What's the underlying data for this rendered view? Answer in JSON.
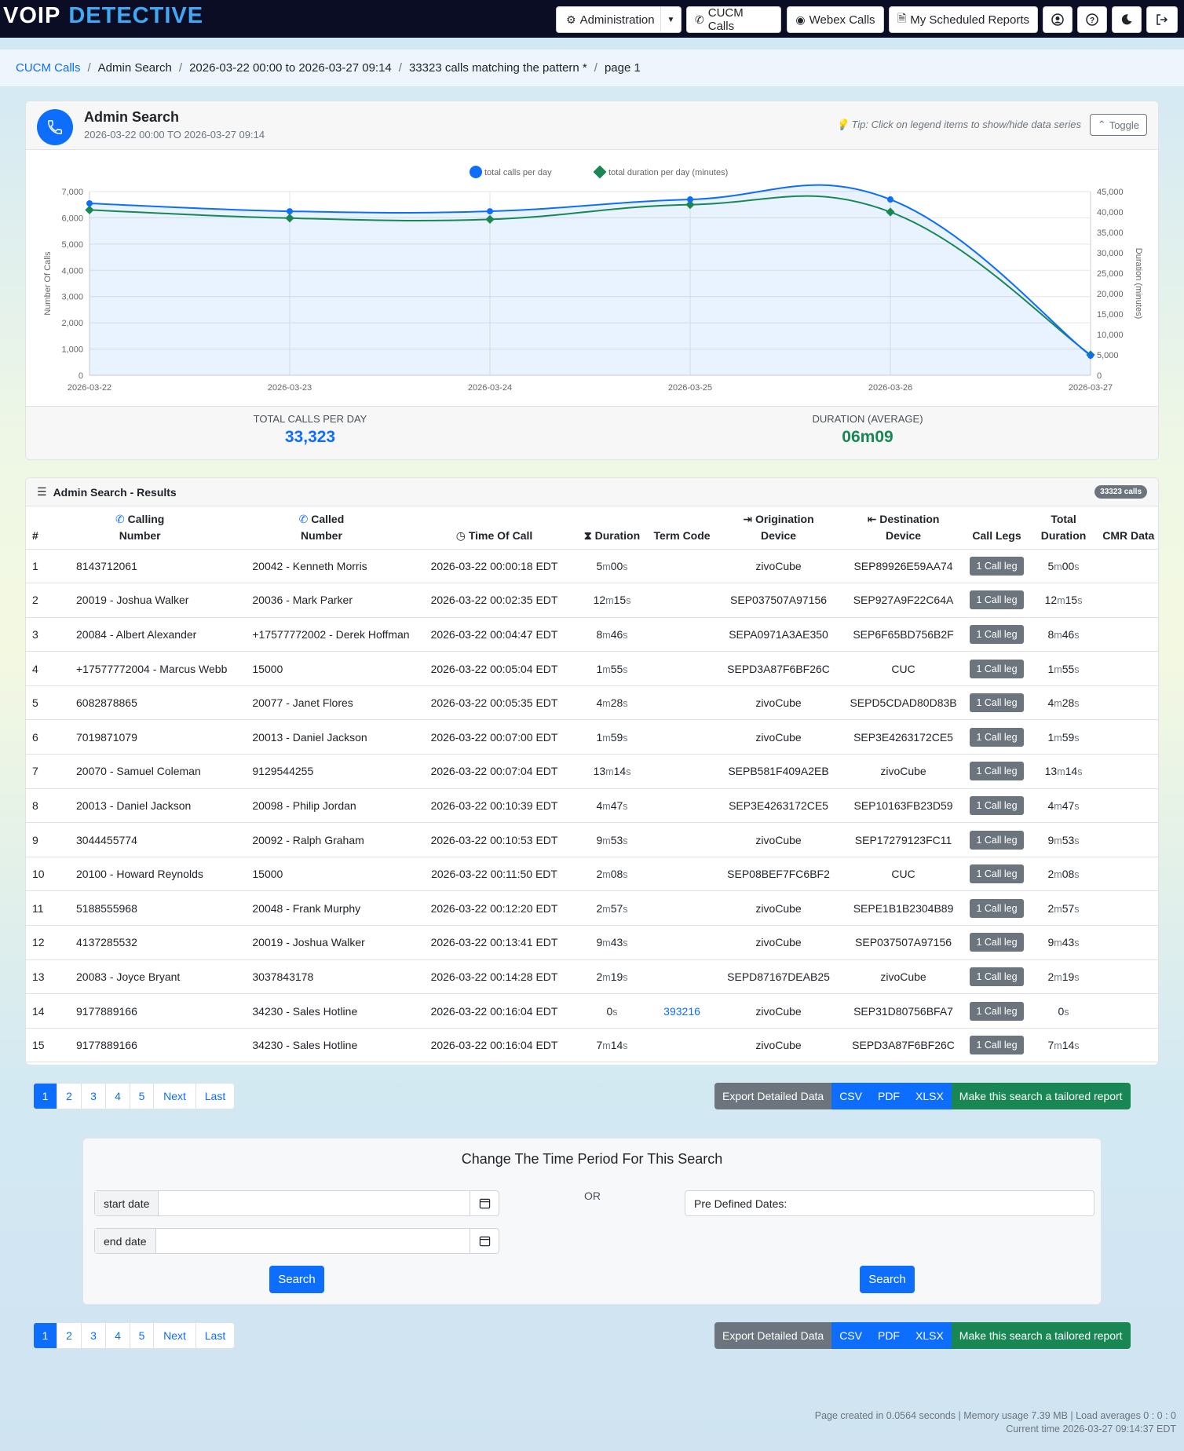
{
  "brand": {
    "voip": "VOIP",
    "detective": "DETECTIVE"
  },
  "nav": {
    "administration": "Administration",
    "cucm_calls": "CUCM Calls",
    "webex_calls": "Webex Calls",
    "scheduled_reports": "My Scheduled Reports"
  },
  "breadcrumb": {
    "root": "CUCM Calls",
    "admin": "Admin Search",
    "range": "2026-03-22 00:00 to 2026-03-27 09:14",
    "matching": "33323 calls matching the pattern *",
    "page": "page 1"
  },
  "chart_card": {
    "title": "Admin Search",
    "subtitle": "2026-03-22 00:00 TO 2026-03-27 09:14",
    "tip": "Tip: Click on legend items to show/hide data series",
    "toggle": "Toggle",
    "stat1_label": "TOTAL CALLS PER DAY",
    "stat1_value": "33,323",
    "stat2_label": "DURATION (AVERAGE)",
    "stat2_value": "06m09"
  },
  "chart_data": {
    "type": "line",
    "x": [
      "2026-03-22",
      "2026-03-23",
      "2026-03-24",
      "2026-03-25",
      "2026-03-26",
      "2026-03-27"
    ],
    "series": [
      {
        "name": "total calls per day",
        "axis": "left",
        "color": "#0d6efd",
        "values": [
          6550,
          6250,
          6250,
          6700,
          6700,
          750
        ]
      },
      {
        "name": "total duration per day (minutes)",
        "axis": "right",
        "color": "#198754",
        "values": [
          40500,
          38500,
          38200,
          41800,
          40000,
          5000
        ]
      }
    ],
    "ylabel": "Number Of Calls",
    "ylabel_right": "Duration (minutes)",
    "ylim": [
      0,
      7000
    ],
    "ylim_right": [
      0,
      45000
    ],
    "yticks": [
      "0",
      "1,000",
      "2,000",
      "3,000",
      "4,000",
      "5,000",
      "6,000",
      "7,000"
    ],
    "yticks_right": [
      "0",
      "5,000",
      "10,000",
      "15,000",
      "20,000",
      "25,000",
      "30,000",
      "35,000",
      "40,000",
      "45,000"
    ],
    "legend": "top-center",
    "grid": true
  },
  "results": {
    "title": "Admin Search - Results",
    "badge": "33323 calls",
    "headers": {
      "num": "#",
      "calling_1": "Calling",
      "calling_2": "Number",
      "called_1": "Called",
      "called_2": "Number",
      "time": "Time Of Call",
      "duration": "Duration",
      "term": "Term Code",
      "orig_1": "Origination",
      "orig_2": "Device",
      "dest_1": "Destination",
      "dest_2": "Device",
      "legs": "Call Legs",
      "total_1": "Total",
      "total_2": "Duration",
      "cmr": "CMR Data"
    },
    "rows": [
      {
        "n": "1",
        "calling": "8143712061",
        "called": "20042 - Kenneth Morris",
        "time": "2026-03-22 00:00:18 EDT",
        "dur": [
          "5",
          "m",
          "00",
          "s"
        ],
        "term": "",
        "orig": "zivoCube",
        "dest": "SEP89926E59AA74",
        "legs": "1 Call leg"
      },
      {
        "n": "2",
        "calling": "20019 - Joshua Walker",
        "called": "20036 - Mark Parker",
        "time": "2026-03-22 00:02:35 EDT",
        "dur": [
          "12",
          "m",
          "15",
          "s"
        ],
        "term": "",
        "orig": "SEP037507A97156",
        "dest": "SEP927A9F22C64A",
        "legs": "1 Call leg"
      },
      {
        "n": "3",
        "calling": "20084 - Albert Alexander",
        "called": "+17577772002 - Derek Hoffman",
        "time": "2026-03-22 00:04:47 EDT",
        "dur": [
          "8",
          "m",
          "46",
          "s"
        ],
        "term": "",
        "orig": "SEPA0971A3AE350",
        "dest": "SEP6F65BD756B2F",
        "legs": "1 Call leg"
      },
      {
        "n": "4",
        "calling": "+17577772004 - Marcus Webb",
        "called": "15000",
        "time": "2026-03-22 00:05:04 EDT",
        "dur": [
          "1",
          "m",
          "55",
          "s"
        ],
        "term": "",
        "orig": "SEPD3A87F6BF26C",
        "dest": "CUC",
        "legs": "1 Call leg"
      },
      {
        "n": "5",
        "calling": "6082878865",
        "called": "20077 - Janet Flores",
        "time": "2026-03-22 00:05:35 EDT",
        "dur": [
          "4",
          "m",
          "28",
          "s"
        ],
        "term": "",
        "orig": "zivoCube",
        "dest": "SEPD5CDAD80D83B",
        "legs": "1 Call leg"
      },
      {
        "n": "6",
        "calling": "7019871079",
        "called": "20013 - Daniel Jackson",
        "time": "2026-03-22 00:07:00 EDT",
        "dur": [
          "1",
          "m",
          "59",
          "s"
        ],
        "term": "",
        "orig": "zivoCube",
        "dest": "SEP3E4263172CE5",
        "legs": "1 Call leg"
      },
      {
        "n": "7",
        "calling": "20070 - Samuel Coleman",
        "called": "9129544255",
        "time": "2026-03-22 00:07:04 EDT",
        "dur": [
          "13",
          "m",
          "14",
          "s"
        ],
        "term": "",
        "orig": "SEPB581F409A2EB",
        "dest": "zivoCube",
        "legs": "1 Call leg"
      },
      {
        "n": "8",
        "calling": "20013 - Daniel Jackson",
        "called": "20098 - Philip Jordan",
        "time": "2026-03-22 00:10:39 EDT",
        "dur": [
          "4",
          "m",
          "47",
          "s"
        ],
        "term": "",
        "orig": "SEP3E4263172CE5",
        "dest": "SEP10163FB23D59",
        "legs": "1 Call leg"
      },
      {
        "n": "9",
        "calling": "3044455774",
        "called": "20092 - Ralph Graham",
        "time": "2026-03-22 00:10:53 EDT",
        "dur": [
          "9",
          "m",
          "53",
          "s"
        ],
        "term": "",
        "orig": "zivoCube",
        "dest": "SEP17279123FC11",
        "legs": "1 Call leg"
      },
      {
        "n": "10",
        "calling": "20100 - Howard Reynolds",
        "called": "15000",
        "time": "2026-03-22 00:11:50 EDT",
        "dur": [
          "2",
          "m",
          "08",
          "s"
        ],
        "term": "",
        "orig": "SEP08BEF7FC6BF2",
        "dest": "CUC",
        "legs": "1 Call leg"
      },
      {
        "n": "11",
        "calling": "5188555968",
        "called": "20048 - Frank Murphy",
        "time": "2026-03-22 00:12:20 EDT",
        "dur": [
          "2",
          "m",
          "57",
          "s"
        ],
        "term": "",
        "orig": "zivoCube",
        "dest": "SEPE1B1B2304B89",
        "legs": "1 Call leg"
      },
      {
        "n": "12",
        "calling": "4137285532",
        "called": "20019 - Joshua Walker",
        "time": "2026-03-22 00:13:41 EDT",
        "dur": [
          "9",
          "m",
          "43",
          "s"
        ],
        "term": "",
        "orig": "zivoCube",
        "dest": "SEP037507A97156",
        "legs": "1 Call leg"
      },
      {
        "n": "13",
        "calling": "20083 - Joyce Bryant",
        "called": "3037843178",
        "time": "2026-03-22 00:14:28 EDT",
        "dur": [
          "2",
          "m",
          "19",
          "s"
        ],
        "term": "",
        "orig": "SEPD87167DEAB25",
        "dest": "zivoCube",
        "legs": "1 Call leg"
      },
      {
        "n": "14",
        "calling": "9177889166",
        "called": "34230 - Sales Hotline",
        "time": "2026-03-22 00:16:04 EDT",
        "dur": [
          "",
          "",
          "0",
          "s"
        ],
        "term": "393216",
        "orig": "zivoCube",
        "dest": "SEP31D80756BFA7",
        "legs": "1 Call leg"
      },
      {
        "n": "15",
        "calling": "9177889166",
        "called": "34230 - Sales Hotline",
        "time": "2026-03-22 00:16:04 EDT",
        "dur": [
          "7",
          "m",
          "14",
          "s"
        ],
        "term": "",
        "orig": "zivoCube",
        "dest": "SEPD3A87F6BF26C",
        "legs": "1 Call leg"
      }
    ]
  },
  "pagination": {
    "pages": [
      "1",
      "2",
      "3",
      "4",
      "5"
    ],
    "next": "Next",
    "last": "Last",
    "active": "1"
  },
  "export": {
    "detailed": "Export Detailed Data",
    "csv": "CSV",
    "pdf": "PDF",
    "xlsx": "XLSX",
    "tailored": "Make this search a tailored report"
  },
  "time_period": {
    "title": "Change The Time Period For This Search",
    "start_label": "start date",
    "end_label": "end date",
    "or": "OR",
    "predefined": "Pre Defined Dates:",
    "search": "Search"
  },
  "footer": {
    "line1": "Page created in 0.0564 seconds | Memory usage 7.39 MB | Load averages 0 : 0 : 0",
    "line2": "Current time 2026-03-27 09:14:37 EDT"
  },
  "colors": {
    "primary": "#0d6efd",
    "success": "#198754",
    "secondary": "#6c757d",
    "navbar": "#0b0d24"
  }
}
